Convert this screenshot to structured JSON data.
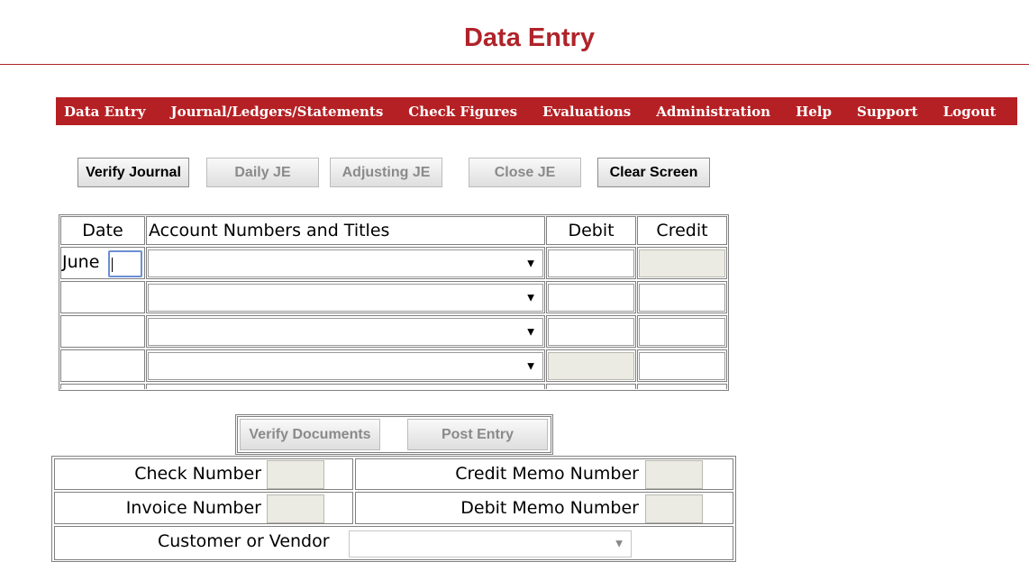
{
  "page": {
    "title": "Data Entry"
  },
  "nav": {
    "items": [
      {
        "label": "Data Entry"
      },
      {
        "label": "Journal/Ledgers/Statements"
      },
      {
        "label": "Check Figures"
      },
      {
        "label": "Evaluations"
      },
      {
        "label": "Administration"
      },
      {
        "label": "Help"
      },
      {
        "label": "Support"
      },
      {
        "label": "Logout"
      }
    ]
  },
  "toolbar": {
    "verify_journal": "Verify Journal",
    "daily_je": "Daily JE",
    "adjusting_je": "Adjusting JE",
    "close_je": "Close JE",
    "clear_screen": "Clear Screen"
  },
  "journal": {
    "headers": {
      "date": "Date",
      "account": "Account Numbers and Titles",
      "debit": "Debit",
      "credit": "Credit"
    },
    "first_row_month": "June",
    "rows": 4
  },
  "actions": {
    "verify_documents": "Verify Documents",
    "post_entry": "Post Entry"
  },
  "documents": {
    "check_number": "Check Number",
    "credit_memo_number": "Credit Memo Number",
    "invoice_number": "Invoice Number",
    "debit_memo_number": "Debit Memo Number",
    "customer_or_vendor": "Customer or Vendor"
  },
  "colors": {
    "brand": "#b52024",
    "title": "#b0232a",
    "disabled_field": "#ebebe4"
  }
}
